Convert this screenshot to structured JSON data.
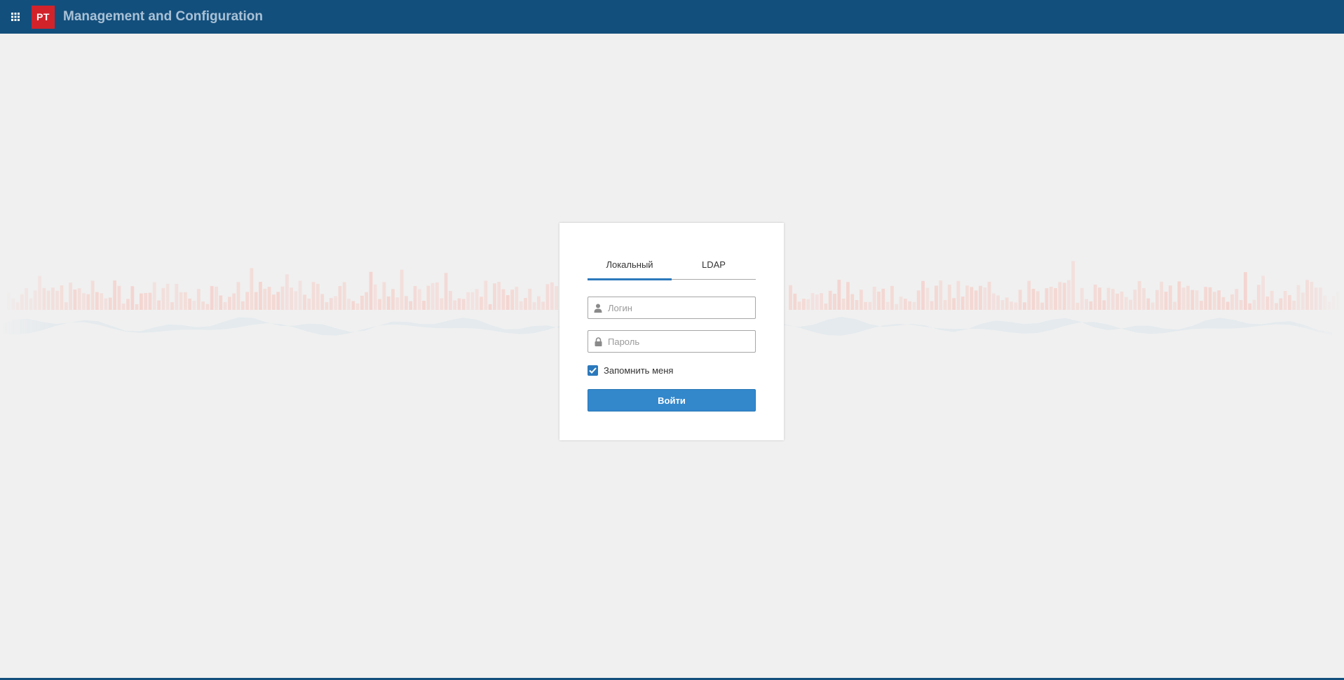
{
  "header": {
    "logo_text": "PT",
    "title": "Management and Configuration",
    "apps_icon": "grid-icon"
  },
  "login": {
    "tabs": [
      {
        "label": "Локальный",
        "active": true
      },
      {
        "label": "LDAP",
        "active": false
      }
    ],
    "login_field": {
      "placeholder": "Логин",
      "value": "",
      "icon": "user-icon"
    },
    "password_field": {
      "placeholder": "Пароль",
      "value": "",
      "icon": "lock-icon"
    },
    "remember": {
      "label": "Запомнить меня",
      "checked": true
    },
    "submit_label": "Войти"
  },
  "colors": {
    "header_bg": "#134f7c",
    "accent": "#2b79bc",
    "button": "#3388cc",
    "logo": "#d2232a",
    "page_bg": "#f0f0f0"
  }
}
